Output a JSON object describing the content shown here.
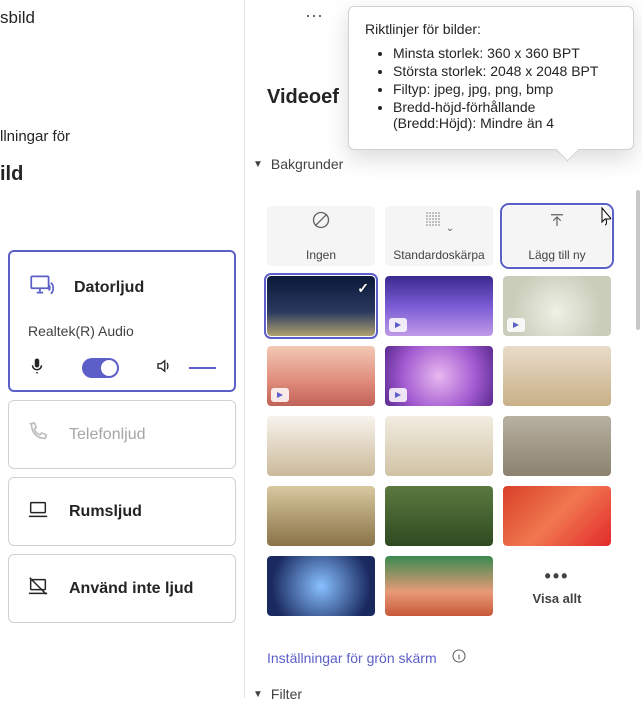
{
  "left": {
    "header_partial": "sbild",
    "settings_partial": "llningar för",
    "bold_partial": "ild",
    "audio_options": {
      "computer": "Datorljud",
      "device": "Realtek(R) Audio",
      "phone": "Telefonljud",
      "room": "Rumsljud",
      "no_audio": "Använd inte ljud"
    }
  },
  "right": {
    "section_title_partial": "Videoef",
    "backgrounds_label": "Bakgrunder",
    "tiles": {
      "none": "Ingen",
      "blur": "Standardoskärpa",
      "add_new": "Lägg till ny",
      "view_all": "Visa allt"
    },
    "green_screen": "Inställningar för grön skärm",
    "filter_label": "Filter"
  },
  "tooltip": {
    "title": "Riktlinjer för bilder:",
    "items": [
      "Minsta storlek: 360 x 360 BPT",
      "Största storlek: 2048 x 2048 BPT",
      "Filtyp: jpeg, jpg, png, bmp",
      "Bredd-höjd-förhållande (Bredd:Höjd): Mindre än 4"
    ]
  }
}
